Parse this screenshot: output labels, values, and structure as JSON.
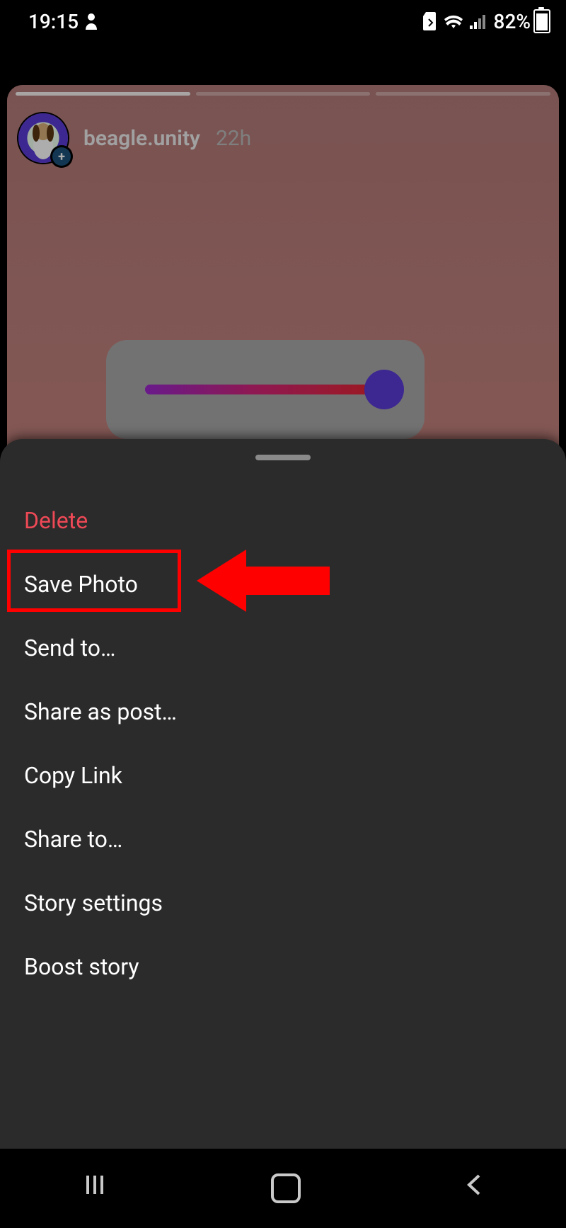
{
  "status": {
    "time": "19:15",
    "battery_pct": "82%"
  },
  "story": {
    "username": "beagle.unity",
    "age": "22h",
    "segments_total": 3,
    "segments_active": 0
  },
  "menu": {
    "delete": "Delete",
    "save_photo": "Save Photo",
    "send_to": "Send to…",
    "share_post": "Share as post…",
    "copy_link": "Copy Link",
    "share_to": "Share to…",
    "story_settings": "Story settings",
    "boost_story": "Boost story"
  },
  "annotation": {
    "target": "save_photo"
  }
}
